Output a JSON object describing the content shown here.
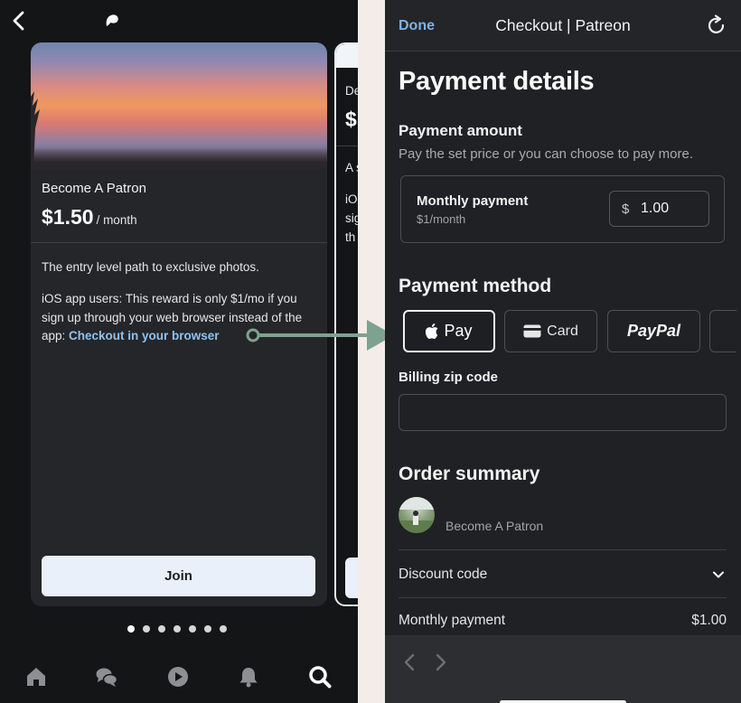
{
  "tier_card": {
    "title": "Become A Patron",
    "price": "$1.50",
    "price_period": "/ month",
    "description": "The entry level path to exclusive photos.",
    "note_text": "iOS app users:  This reward is only $1/mo if you sign up through your web browser instead of the app: ",
    "note_link": "Checkout in your browser",
    "join_label": "Join"
  },
  "next_card": {
    "title_fragment": "De",
    "price_fragment": "$",
    "desc_fragment": "A s",
    "note_lines": [
      "iO",
      "sig",
      "th"
    ]
  },
  "carousel": {
    "dot_count": 7,
    "active_index": 0
  },
  "bottom_nav": [
    "home-icon",
    "chat-icon",
    "play-icon",
    "bell-icon",
    "search-icon"
  ],
  "checkout": {
    "done_label": "Done",
    "title": "Checkout | Patreon",
    "heading": "Payment details",
    "payment_amount": {
      "heading": "Payment amount",
      "subtitle": "Pay the set price or you can choose to pay more.",
      "label": "Monthly payment",
      "hint": "$1/month",
      "currency": "$",
      "value": "1.00"
    },
    "payment_method": {
      "heading": "Payment method",
      "options": {
        "apple_pay": "Pay",
        "card": "Card",
        "paypal": "PayPal"
      }
    },
    "billing": {
      "label": "Billing zip code",
      "value": ""
    },
    "order_summary": {
      "heading": "Order summary",
      "tier": "Become A Patron",
      "discount_label": "Discount code",
      "monthly_label": "Monthly payment",
      "monthly_value": "$1.00"
    }
  },
  "colors": {
    "link": "#8ec2f2",
    "done": "#7fb2e6",
    "connector": "#7ea28d",
    "background_left": "#131517",
    "background_right": "#1f2124"
  }
}
